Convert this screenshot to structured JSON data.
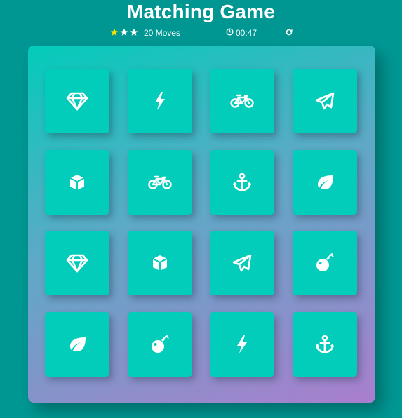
{
  "game": {
    "title": "Matching Game"
  },
  "score_panel": {
    "stars": 3,
    "star_color": "#ffe100",
    "moves_label": "20 Moves",
    "timer": "00:47",
    "timer_icon": "clock-icon",
    "restart_icon": "restart-icon"
  },
  "colors": {
    "background": "#009793",
    "card": "#02ccba",
    "deck_gradient": [
      "#02ccba",
      "#aa7ecd"
    ]
  },
  "deck": {
    "rows": [
      [
        "diamond",
        "bolt",
        "bicycle",
        "paper-plane"
      ],
      [
        "cube",
        "bicycle",
        "anchor",
        "leaf"
      ],
      [
        "diamond",
        "cube",
        "paper-plane",
        "bomb"
      ],
      [
        "leaf",
        "bomb",
        "bolt",
        "anchor"
      ]
    ]
  }
}
